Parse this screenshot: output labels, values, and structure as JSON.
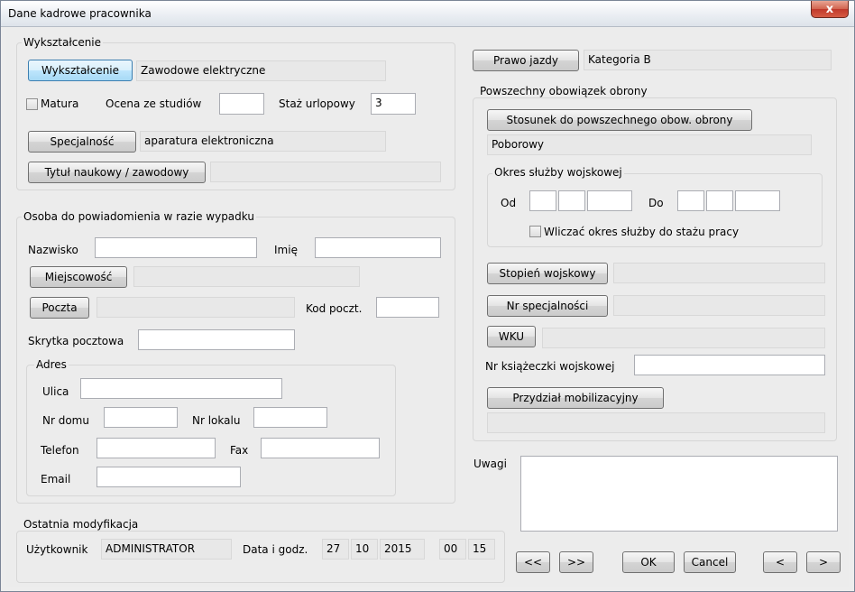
{
  "window": {
    "title": "Dane kadrowe pracownika",
    "close_glyph": "x"
  },
  "education": {
    "group_title": "Wykształcenie",
    "button": "Wykształcenie",
    "value": "Zawodowe elektryczne",
    "matura_label": "Matura",
    "grade_label": "Ocena ze studiów",
    "grade_value": "",
    "seniority_label": "Staż urlopowy",
    "seniority_value": "3",
    "specialty_button": "Specjalność",
    "specialty_value": "aparatura elektroniczna",
    "title_button": "Tytuł naukowy / zawodowy",
    "title_value": ""
  },
  "emergency": {
    "group_title": "Osoba do powiadomienia w razie wypadku",
    "surname_label": "Nazwisko",
    "name_label": "Imię",
    "city_button": "Miejscowość",
    "post_button": "Poczta",
    "postcode_label": "Kod poczt.",
    "pobox_label": "Skrytka pocztowa",
    "address": {
      "group_title": "Adres",
      "street_label": "Ulica",
      "house_label": "Nr domu",
      "flat_label": "Nr lokalu",
      "phone_label": "Telefon",
      "fax_label": "Fax",
      "email_label": "Email"
    }
  },
  "last_modified": {
    "group_title": "Ostatnia modyfikacja",
    "user_label": "Użytkownik",
    "user_value": "ADMINISTRATOR",
    "date_label": "Data i godz.",
    "day": "27",
    "month": "10",
    "year": "2015",
    "hour": "00",
    "minute": "15"
  },
  "license": {
    "button": "Prawo jazdy",
    "value": "Kategoria B"
  },
  "military": {
    "group_title": "Powszechny obowiązek obrony",
    "relation_button": "Stosunek do powszechnego obow. obrony",
    "relation_value": "Poborowy",
    "service": {
      "group_title": "Okres służby wojskowej",
      "from_label": "Od",
      "to_label": "Do",
      "include_label": "Wliczać okres służby do stażu pracy"
    },
    "rank_button": "Stopień wojskowy",
    "specialty_button": "Nr specjalności",
    "wku_button": "WKU",
    "booklet_label": "Nr książeczki wojskowej",
    "mobilization_button": "Przydział mobilizacyjny"
  },
  "notes": {
    "label": "Uwagi"
  },
  "footer": {
    "first": "<<",
    "prev_page": ">>",
    "ok": "OK",
    "cancel": "Cancel",
    "prev": "<",
    "next": ">"
  }
}
